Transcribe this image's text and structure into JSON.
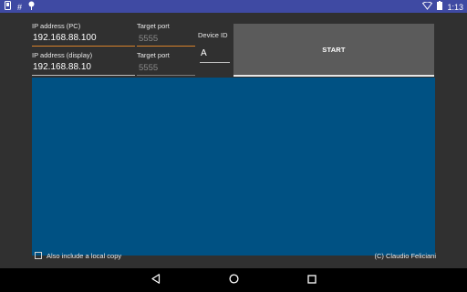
{
  "status_bar": {
    "left_icons": [
      "phone-icon",
      "hash-icon",
      "pin-icon"
    ],
    "right_icons": [
      "wifi-icon",
      "battery-icon"
    ],
    "time": "1:13"
  },
  "form": {
    "ip_pc_label": "IP address (PC)",
    "ip_pc_value": "192.168.88.100",
    "port_pc_label": "Target port",
    "port_pc_value": "5555",
    "ip_display_label": "IP address (display)",
    "ip_display_value": "192.168.88.10",
    "port_display_label": "Target port",
    "port_display_value": "5555",
    "device_id_label": "Device ID",
    "device_id_value": "A",
    "start_label": "START"
  },
  "display": {
    "background": "#005183"
  },
  "footer": {
    "checkbox_label": "Also include a local copy",
    "credits": "(C) Claudio Feliciani"
  },
  "nav_bar": {
    "buttons": [
      "back-icon",
      "home-icon",
      "recents-icon"
    ]
  },
  "colors": {
    "status_bar": "#3f4aa3",
    "background": "#303030",
    "accent_underline": "#d9822b",
    "button": "#5b5b5b"
  }
}
